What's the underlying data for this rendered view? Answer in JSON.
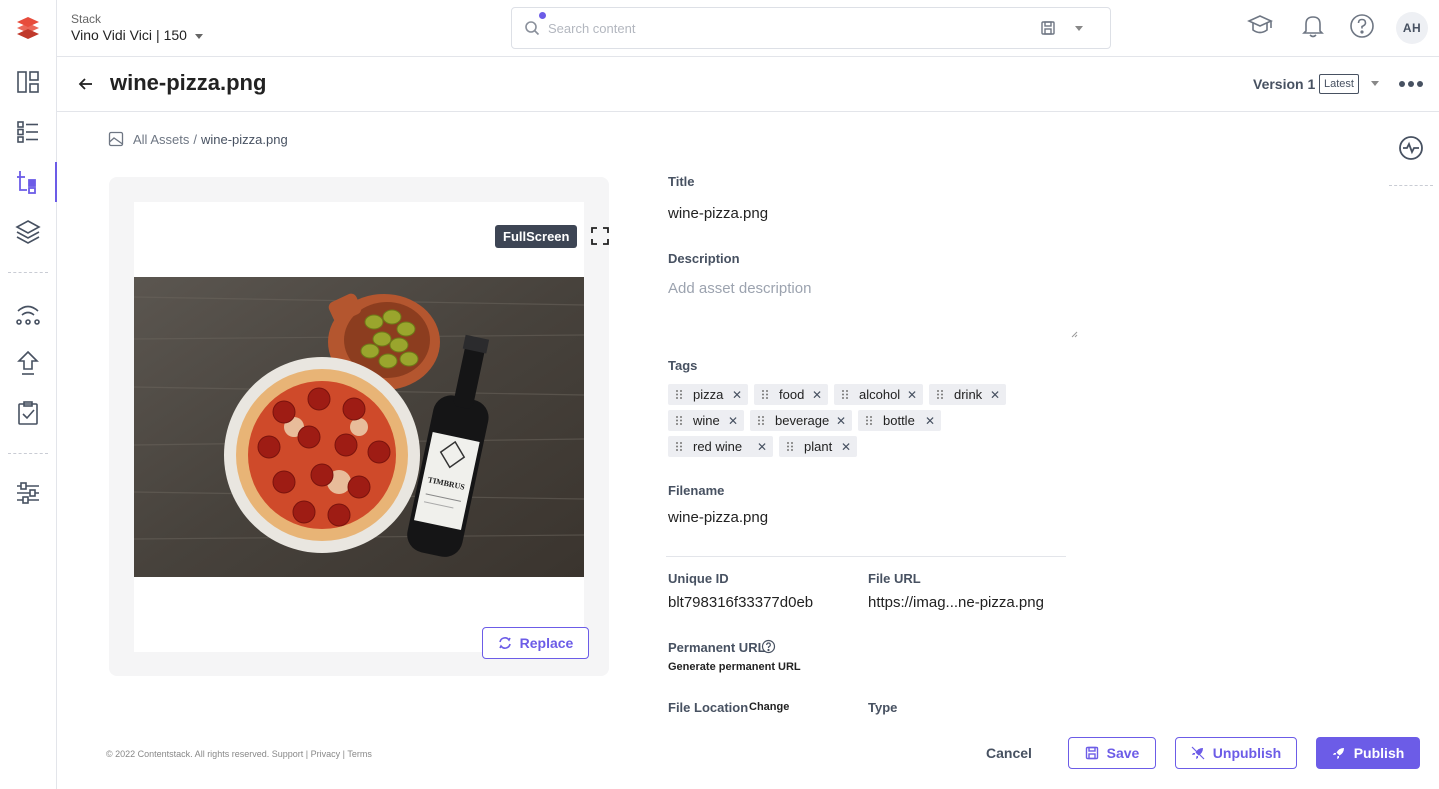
{
  "header": {
    "stack_label": "Stack",
    "stack_name": "Vino Vidi Vici",
    "stack_separator": "|",
    "stack_count": "150",
    "search_placeholder": "Search content",
    "avatar_initials": "AH"
  },
  "page": {
    "title": "wine-pizza.png",
    "version_label": "Version 1",
    "version_badge": "Latest"
  },
  "breadcrumb": {
    "root": "All Assets",
    "separator": "/",
    "current": "wine-pizza.png"
  },
  "preview": {
    "fullscreen_label": "FullScreen",
    "replace_label": "Replace",
    "bottle_label": "TIMBRUS"
  },
  "fields": {
    "title_label": "Title",
    "title_value": "wine-pizza.png",
    "description_label": "Description",
    "description_placeholder": "Add asset description",
    "tags_label": "Tags",
    "tags": [
      "pizza",
      "food",
      "alcohol",
      "drink",
      "wine",
      "beverage",
      "bottle",
      "red wine",
      "plant"
    ],
    "filename_label": "Filename",
    "filename_value": "wine-pizza.png",
    "uid_label": "Unique ID",
    "uid_value": "blt798316f33377d0eb",
    "file_url_label": "File URL",
    "file_url_value": "https://imag...ne-pizza.png",
    "permanent_url_label": "Permanent URL",
    "generate_permanent_url": "Generate permanent URL",
    "file_location_label": "File Location",
    "change_label": "Change",
    "type_label": "Type"
  },
  "footer": {
    "copyright": "© 2022 Contentstack. All rights reserved.",
    "support": "Support",
    "privacy": "Privacy",
    "terms": "Terms",
    "link_separator": "|"
  },
  "actions": {
    "cancel": "Cancel",
    "save": "Save",
    "unpublish": "Unpublish",
    "publish": "Publish"
  },
  "colors": {
    "accent": "#6c5ce7",
    "brand_red": "#e74c3c",
    "label": "#475161",
    "placeholder": "#9ca3af"
  },
  "icons": {
    "rail": [
      "dashboard-icon",
      "content-models-icon",
      "entries-icon",
      "assets-icon",
      "releases-icon",
      "deploy-icon",
      "tasks-icon",
      "settings-icon"
    ],
    "top": [
      "academy-icon",
      "bell-icon",
      "help-icon"
    ]
  }
}
